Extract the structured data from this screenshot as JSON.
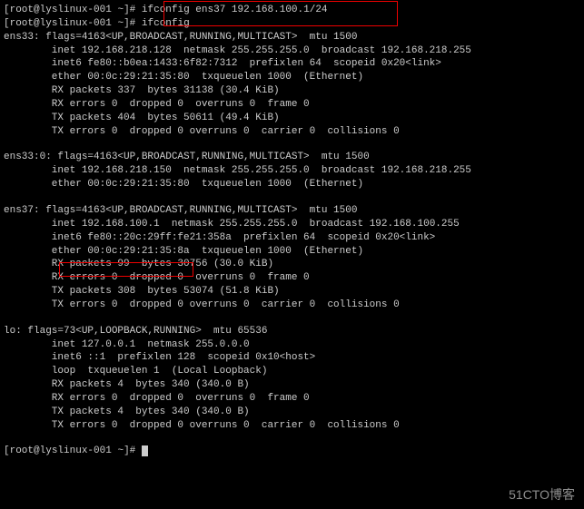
{
  "prompt": {
    "user": "root",
    "host": "lyslinux-001",
    "path": "~",
    "symbol": "#"
  },
  "commands": {
    "cmd1": "ifconfig ens37 192.168.100.1/24",
    "cmd2": "ifconfig"
  },
  "ens33": {
    "header": "ens33: flags=4163<UP,BROADCAST,RUNNING,MULTICAST>  mtu 1500",
    "inet": "        inet 192.168.218.128  netmask 255.255.255.0  broadcast 192.168.218.255",
    "inet6": "        inet6 fe80::b0ea:1433:6f82:7312  prefixlen 64  scopeid 0x20<link>",
    "ether": "        ether 00:0c:29:21:35:80  txqueuelen 1000  (Ethernet)",
    "rxp": "        RX packets 337  bytes 31138 (30.4 KiB)",
    "rxe": "        RX errors 0  dropped 0  overruns 0  frame 0",
    "txp": "        TX packets 404  bytes 50611 (49.4 KiB)",
    "txe": "        TX errors 0  dropped 0 overruns 0  carrier 0  collisions 0"
  },
  "ens33_0": {
    "header": "ens33:0: flags=4163<UP,BROADCAST,RUNNING,MULTICAST>  mtu 1500",
    "inet": "        inet 192.168.218.150  netmask 255.255.255.0  broadcast 192.168.218.255",
    "ether": "        ether 00:0c:29:21:35:80  txqueuelen 1000  (Ethernet)"
  },
  "ens37": {
    "header": "ens37: flags=4163<UP,BROADCAST,RUNNING,MULTICAST>  mtu 1500",
    "inet_pre": "        inet ",
    "inet_ip": "192.168.100.1",
    "inet_post": "  netmask 255.255.255.0  broadcast 192.168.100.255",
    "inet6": "        inet6 fe80::20c:29ff:fe21:358a  prefixlen 64  scopeid 0x20<link>",
    "ether": "        ether 00:0c:29:21:35:8a  txqueuelen 1000  (Ethernet)",
    "rxp": "        RX packets 99  bytes 30756 (30.0 KiB)",
    "rxe": "        RX errors 0  dropped 0  overruns 0  frame 0",
    "txp": "        TX packets 308  bytes 53074 (51.8 KiB)",
    "txe": "        TX errors 0  dropped 0 overruns 0  carrier 0  collisions 0"
  },
  "lo": {
    "header": "lo: flags=73<UP,LOOPBACK,RUNNING>  mtu 65536",
    "inet": "        inet 127.0.0.1  netmask 255.0.0.0",
    "inet6": "        inet6 ::1  prefixlen 128  scopeid 0x10<host>",
    "loop": "        loop  txqueuelen 1  (Local Loopback)",
    "rxp": "        RX packets 4  bytes 340 (340.0 B)",
    "rxe": "        RX errors 0  dropped 0  overruns 0  frame 0",
    "txp": "        TX packets 4  bytes 340 (340.0 B)",
    "txe": "        TX errors 0  dropped 0 overruns 0  carrier 0  collisions 0"
  },
  "watermark": "51CTO博客"
}
